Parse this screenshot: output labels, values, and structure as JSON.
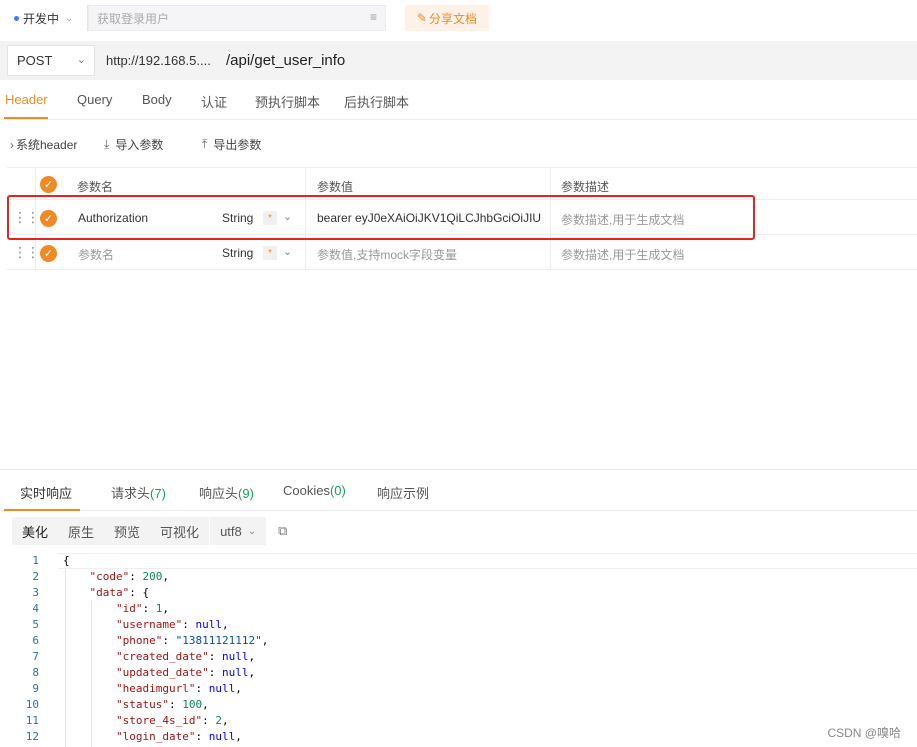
{
  "toolbar": {
    "env_label": "开发中",
    "login_placeholder": "获取登录用户",
    "share_label": "分享文档"
  },
  "request": {
    "method": "POST",
    "url_host": "http://192.168.5....",
    "url_path": "/api/get_user_info"
  },
  "req_tabs": [
    "Header",
    "Query",
    "Body",
    "认证",
    "预执行脚本",
    "后执行脚本"
  ],
  "sub_toolbar": {
    "system_header": "系统header",
    "import_params": "导入参数",
    "export_params": "导出参数"
  },
  "param_table": {
    "headers": [
      "参数名",
      "参数值",
      "参数描述"
    ],
    "rows": [
      {
        "name": "Authorization",
        "type": "String",
        "required": "*",
        "value": "bearer eyJ0eXAiOiJKV1QiLCJhbGciOiJIU",
        "desc_placeholder": "参数描述,用于生成文档"
      },
      {
        "name_placeholder": "参数名",
        "type": "String",
        "required": "*",
        "value_placeholder": "参数值,支持mock字段变量",
        "desc_placeholder": "参数描述,用于生成文档"
      }
    ]
  },
  "resp_tabs": [
    {
      "label": "实时响应",
      "count": ""
    },
    {
      "label": "请求头",
      "count": "(7)"
    },
    {
      "label": "响应头",
      "count": "(9)"
    },
    {
      "label": "Cookies",
      "count": "(0)"
    },
    {
      "label": "响应示例",
      "count": ""
    }
  ],
  "format_bar": {
    "options": [
      "美化",
      "原生",
      "预览",
      "可视化"
    ],
    "encoding": "utf8"
  },
  "code_lines": [
    "{",
    "    \"code\": 200,",
    "    \"data\": {",
    "        \"id\": 1,",
    "        \"username\": null,",
    "        \"phone\": \"13811121112\",",
    "        \"created_date\": null,",
    "        \"updated_date\": null,",
    "        \"headimgurl\": null,",
    "        \"status\": 100,",
    "        \"store_4s_id\": 2,",
    "        \"login_date\": null,"
  ],
  "watermark": "CSDN @嗅哈",
  "colors": {
    "accent": "#f08a24",
    "highlight_border": "#e5231f",
    "count_green": "#18a058"
  },
  "icons": [
    "chevron-down-icon",
    "list-icon",
    "share-icon",
    "chevron-right-icon",
    "import-icon",
    "export-icon",
    "check-icon",
    "drag-handle-icon",
    "copy-icon"
  ]
}
